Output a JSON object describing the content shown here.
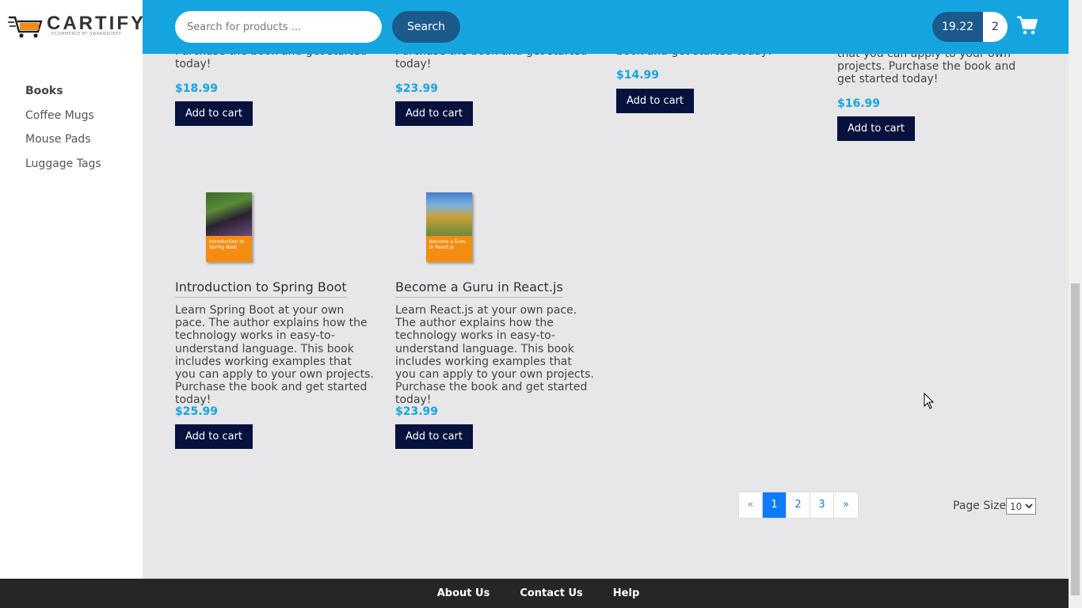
{
  "brand": {
    "name": "CARTIFY",
    "tagline": "ECOMMERCE BY SWARNADEEP"
  },
  "sidebar": {
    "items": [
      {
        "label": "Books",
        "active": true
      },
      {
        "label": "Coffee Mugs"
      },
      {
        "label": "Mouse Pads"
      },
      {
        "label": "Luggage Tags"
      }
    ]
  },
  "header": {
    "search_placeholder": "Search for products ...",
    "search_button": "Search",
    "cart_total": "19.22",
    "cart_count": "2",
    "cart_icon": "shopping-cart-icon"
  },
  "products_top": [
    {
      "desc_tail": "Purchase the book and get started today!",
      "price": "$18.99",
      "button": "Add to cart"
    },
    {
      "desc_tail": "Purchase the book and get started today!",
      "price": "$23.99",
      "button": "Add to cart"
    },
    {
      "desc_tail": "book and get started today!",
      "price": "$14.99",
      "button": "Add to cart"
    },
    {
      "desc_tail": "that you can apply to your own projects. Purchase the book and get started today!",
      "price": "$16.99",
      "button": "Add to cart"
    }
  ],
  "products": [
    {
      "title": "Introduction to Spring Boot",
      "cover_text": "Introduction to Spring Boot",
      "description": "Learn Spring Boot at your own pace. The author explains how the technology works in easy-to-understand language. This book includes working examples that you can apply to your own projects. Purchase the book and get started today!",
      "price": "$25.99",
      "button": "Add to cart"
    },
    {
      "title": "Become a Guru in React.js",
      "cover_text": "Become a Guru in React.js",
      "description": "Learn React.js at your own pace. The author explains how the technology works in easy-to-understand language. This book includes working examples that you can apply to your own projects. Purchase the book and get started today!",
      "price": "$23.99",
      "button": "Add to cart"
    }
  ],
  "pagination": {
    "prev": "«",
    "pages": [
      "1",
      "2",
      "3"
    ],
    "current": "1",
    "next": "»",
    "page_size_label": "Page Size",
    "page_size": "10"
  },
  "footer": {
    "links": [
      "About Us",
      "Contact Us",
      "Help"
    ]
  },
  "colors": {
    "header": "#14a5e0",
    "accent_dark": "#1c5a8c",
    "button": "#06123d",
    "price": "#14a5e0",
    "footer": "#262626"
  }
}
